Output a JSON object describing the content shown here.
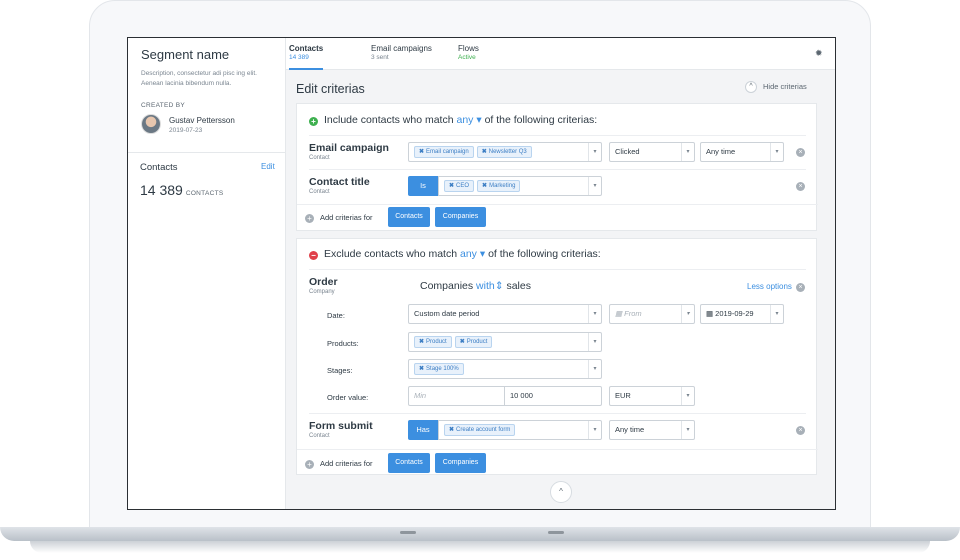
{
  "segment": {
    "name": "Segment name",
    "description": "Description, consectetur adi pisc ing elit. Aenean lacinia bibendum nulla.",
    "created_by_label": "CREATED BY",
    "author_name": "Gustav Pettersson",
    "author_date": "2019-07-23",
    "contacts_label": "Contacts",
    "edit_label": "Edit",
    "contacts_count": "14 389",
    "contacts_unit": "CONTACTS"
  },
  "tabs": [
    {
      "label": "Contacts",
      "sub": "14 389"
    },
    {
      "label": "Email campaigns",
      "sub": "3 sent"
    },
    {
      "label": "Flows",
      "sub": "Active"
    }
  ],
  "icons": {
    "settings": "gear-icon"
  },
  "editor": {
    "title": "Edit criterias",
    "hide_label": "Hide criterias"
  },
  "include": {
    "prefix": "Include contacts who match",
    "match": "any",
    "suffix": "of the following criterias:",
    "criteria": [
      {
        "name": "Email campaign",
        "sub": "Contact",
        "chips": [
          "Email campaign",
          "Newsletter Q3"
        ],
        "action": "Clicked",
        "time": "Any time"
      },
      {
        "name": "Contact title",
        "sub": "Contact",
        "operator": "Is",
        "chips": [
          "CEO",
          "Marketing"
        ]
      }
    ],
    "add_label": "Add criterias for",
    "add_contacts": "Contacts",
    "add_companies": "Companies"
  },
  "exclude": {
    "prefix": "Exclude contacts who match",
    "match": "any",
    "suffix": "of the following criterias:",
    "order": {
      "name": "Order",
      "sub": "Company",
      "line_prefix": "Companies",
      "line_with": "with",
      "line_suffix": "sales",
      "less_options": "Less options",
      "date_label": "Date:",
      "date_value": "Custom date period",
      "from_placeholder": "From",
      "to_value": "2019-09-29",
      "products_label": "Products:",
      "products_chips": [
        "Product",
        "Product"
      ],
      "stages_label": "Stages:",
      "stages_chips": [
        "Stage 100%"
      ],
      "value_label": "Order value:",
      "min_placeholder": "Min",
      "max_value": "10 000",
      "currency": "EUR"
    },
    "form": {
      "name": "Form submit",
      "sub": "Contact",
      "operator": "Has",
      "chips": [
        "Create account form"
      ],
      "time": "Any time"
    },
    "add_label": "Add criterias for",
    "add_contacts": "Contacts",
    "add_companies": "Companies"
  }
}
